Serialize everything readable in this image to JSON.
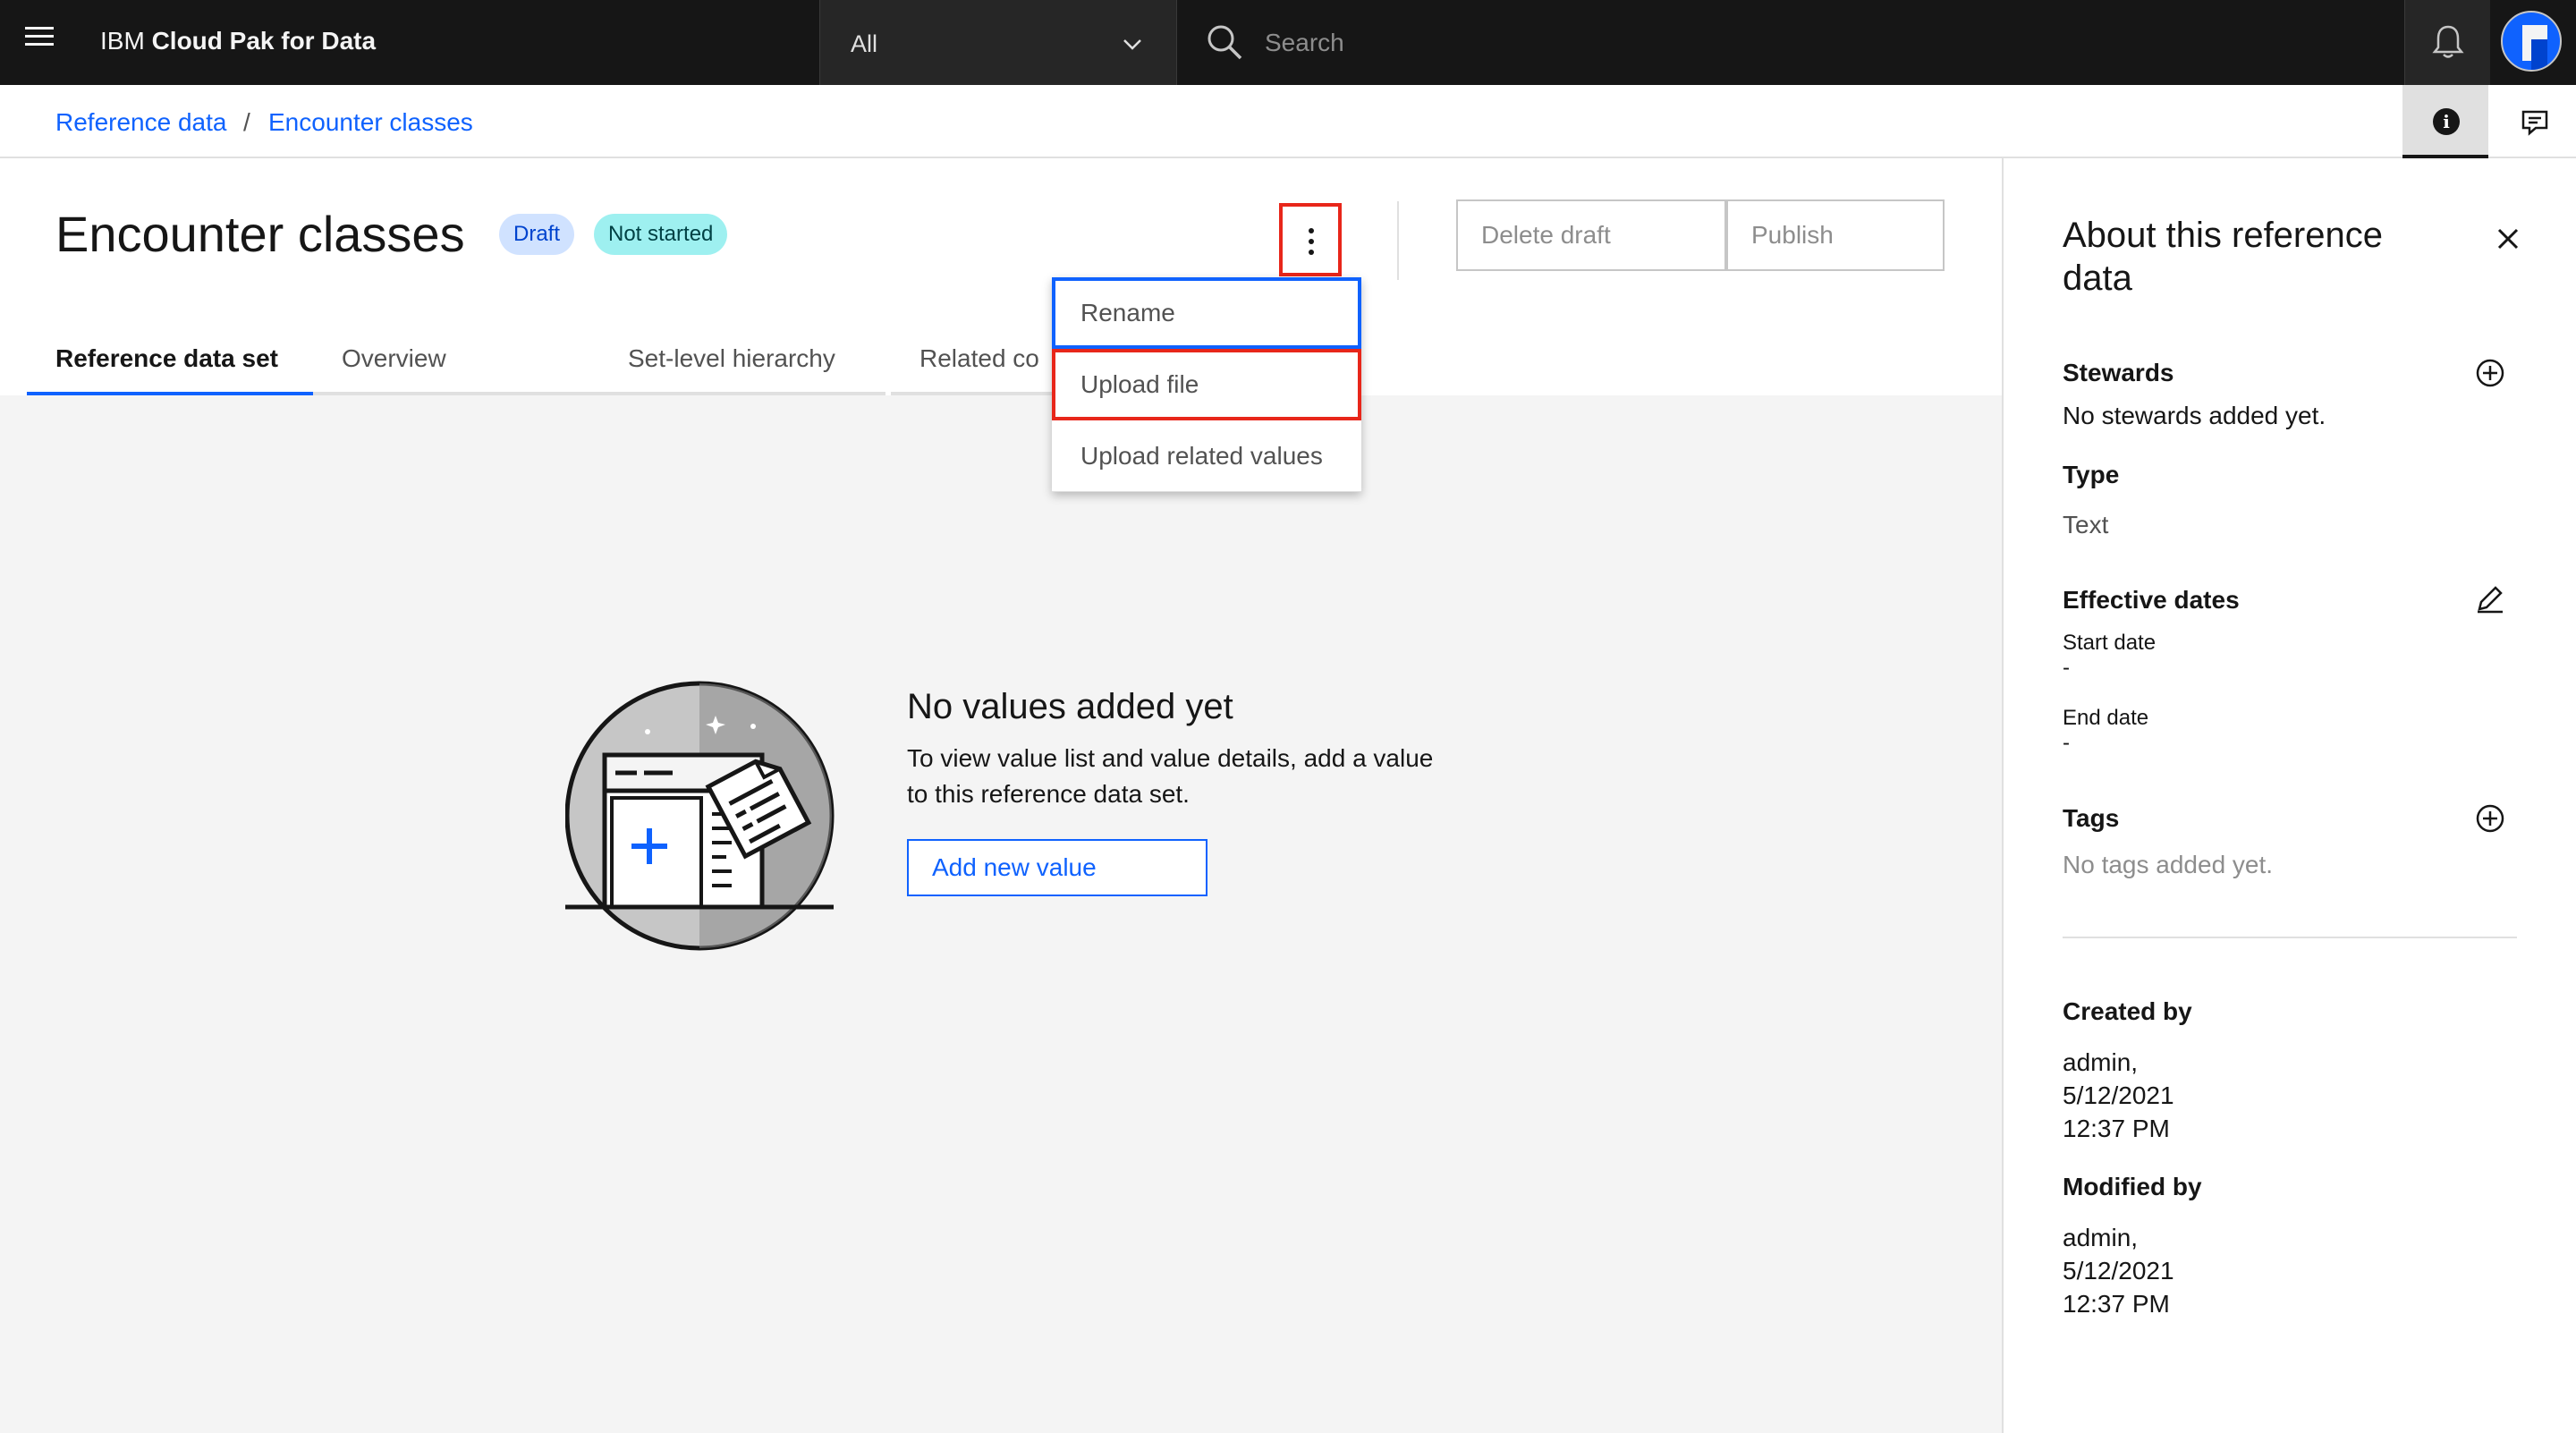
{
  "header": {
    "brand_prefix": "IBM",
    "brand_name": "Cloud Pak for Data",
    "scope": "All",
    "search_placeholder": "Search"
  },
  "breadcrumb": {
    "items": [
      "Reference data",
      "Encounter classes"
    ],
    "separator": "/"
  },
  "page": {
    "title": "Encounter classes",
    "tags": [
      "Draft",
      "Not started"
    ],
    "buttons": {
      "delete": "Delete draft",
      "publish": "Publish"
    },
    "tabs": [
      "Reference data set",
      "Overview",
      "Set-level hierarchy",
      "Related co"
    ]
  },
  "menu": {
    "items": [
      "Rename",
      "Upload file",
      "Upload related values"
    ]
  },
  "empty": {
    "title": "No values added yet",
    "line1": "To view value list and value details, add a value",
    "line2": "to this reference data set.",
    "button": "Add new value"
  },
  "side": {
    "title_line1": "About this reference",
    "title_line2": "data",
    "stewards_label": "Stewards",
    "stewards_value": "No stewards added yet.",
    "type_label": "Type",
    "type_value": "Text",
    "dates_label": "Effective dates",
    "start_label": "Start date",
    "start_value": "-",
    "end_label": "End date",
    "end_value": "-",
    "tags_label": "Tags",
    "tags_value": "No tags added yet.",
    "created_label": "Created by",
    "created_user": "admin,",
    "created_date": "5/12/2021",
    "created_time": "12:37 PM",
    "modified_label": "Modified by",
    "modified_user": "admin,",
    "modified_date": "5/12/2021",
    "modified_time": "12:37 PM"
  },
  "colors": {
    "accent": "#0f62fe",
    "highlight_box": "#e8261a",
    "header_bg": "#161616"
  }
}
